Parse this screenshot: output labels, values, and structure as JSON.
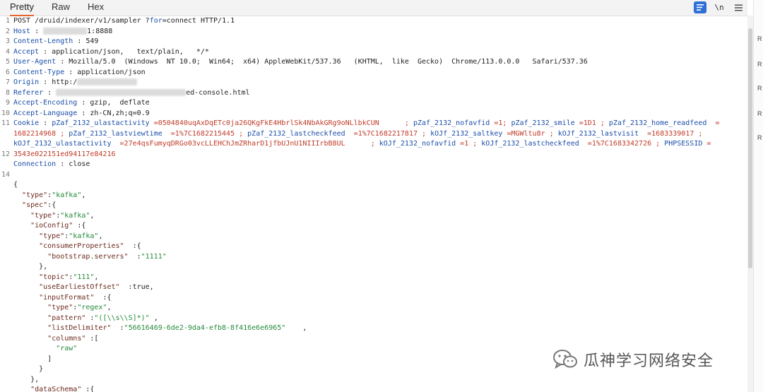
{
  "tabs": [
    "Pretty",
    "Raw",
    "Hex"
  ],
  "toolbar": {
    "newline_label": "\\n",
    "wrap_icon": "wrap-lines-icon",
    "menu_icon": "hamburger-menu-icon"
  },
  "colors": {
    "accent": "#e8642c",
    "key": "#1b4ea8",
    "cookie_value": "#c03b28",
    "json_key": "#6b2a1d",
    "json_string": "#248a3a"
  },
  "request": {
    "method": "POST",
    "path": "/druid/indexer/v1/sampler",
    "query_pre": "?",
    "query_key": "for",
    "query_rest": "=connect",
    "protocol": "HTTP/1.1",
    "headers": {
      "host_name": "Host",
      "host_sep": " : ",
      "host_value": "1:8888",
      "content_length_name": "Content-Length",
      "content_length_value": " : 549",
      "accept_name": "Accept",
      "accept_value": " : application/json,   text/plain,   */*",
      "user_agent_name": "User-Agent",
      "user_agent_value": " : Mozilla/5.0  (Windows  NT 10.0;  Win64;  x64) AppleWebKit/537.36   (KHTML,  like  Gecko)  Chrome/113.0.0.0   Safari/537.36",
      "content_type_name": "Content-Type",
      "content_type_value": " : application/json",
      "origin_name": "Origin",
      "origin_sep": " : ",
      "origin_value": "http:/",
      "referer_name": "Referer",
      "referer_sep": " : ",
      "referer_value": "ed-console.html",
      "accept_encoding_name": "Accept-Encoding",
      "accept_encoding_value": " : gzip,  deflate",
      "accept_language_name": "Accept-Language",
      "accept_language_value": " : zh-CN,zh;q=0.9",
      "cookie_name": "Cookie",
      "cookie_sep": " : ",
      "cookie": [
        {
          "key": "pZaf_2132_ulastactivity",
          "value": " =0504840uqAxDqETc0ja26QKgFkE4HbrlSk4NbAkGRg9oNLlbkCUN      ; "
        },
        {
          "key": "pZaf_2132_nofavfid",
          "value": " =1; "
        },
        {
          "key": "pZaf_2132_smile",
          "value": " =1D1 ; "
        },
        {
          "key": "pZaf_2132_home_readfeed",
          "value": "  =\n1682214968 ; "
        },
        {
          "key": "pZaf_2132_lastviewtime",
          "value": "  =1%7C1682215445 ; "
        },
        {
          "key": "pZaf_2132_lastcheckfeed",
          "value": "  =1%7C1682217817 ; "
        },
        {
          "key": "kOJf_2132_saltkey",
          "value": " =MGWltu8r ; "
        },
        {
          "key": "kOJf_2132_lastvisit",
          "value": "  =1683339017 ;\n"
        },
        {
          "key": "kOJf_2132_ulastactivity",
          "value": "  =27e4qsFumyqDRGo03vcLLEHChJmZRharD1jfbUJnU1NIIIrbB8UL      ; "
        },
        {
          "key": "kOJf_2132_nofavfid",
          "value": " =1 ; "
        },
        {
          "key": "kOJf_2132_lastcheckfeed",
          "value": "  =1%7C1683342726 ; "
        },
        {
          "key": "PHPSESSID",
          "value": " =\n3543e022151ed94117e84216"
        }
      ],
      "connection_name": "Connection",
      "connection_value": " : close"
    }
  },
  "body": {
    "type_key": "\"type\"",
    "type_value": "\"kafka\"",
    "spec_key": "\"spec\"",
    "spec_type_key": "\"type\"",
    "spec_type_value": "\"kafka\"",
    "ioconfig_key": "\"ioConfig\"",
    "io_type_key": "\"type\"",
    "io_type_value": "\"kafka\"",
    "consumer_key": "\"consumerProperties\"",
    "bootstrap_key": "\"bootstrap.servers\"",
    "bootstrap_value": "\"1111\"",
    "topic_key": "\"topic\"",
    "topic_value": "\"111\"",
    "earliest_key": "\"useEarliestOffset\"",
    "earliest_value": "true",
    "input_format_key": "\"inputFormat\"",
    "if_type_key": "\"type\"",
    "if_type_value": "\"regex\"",
    "pattern_key": "\"pattern\"",
    "pattern_value": "\"([\\\\s\\\\S]*)\"",
    "delimiter_key": "\"listDelimiter\"",
    "delimiter_value": "\"56616469-6de2-9da4-efb8-8f416e6e6965\"",
    "columns_key": "\"columns\"",
    "columns_value": "\"raw\"",
    "last_key": "\"dataSchema\""
  },
  "watermark": {
    "text": "瓜神学习网络安全",
    "icon": "wechat-icon"
  },
  "right_panel": [
    "R",
    "R",
    "R",
    "R",
    "R"
  ]
}
